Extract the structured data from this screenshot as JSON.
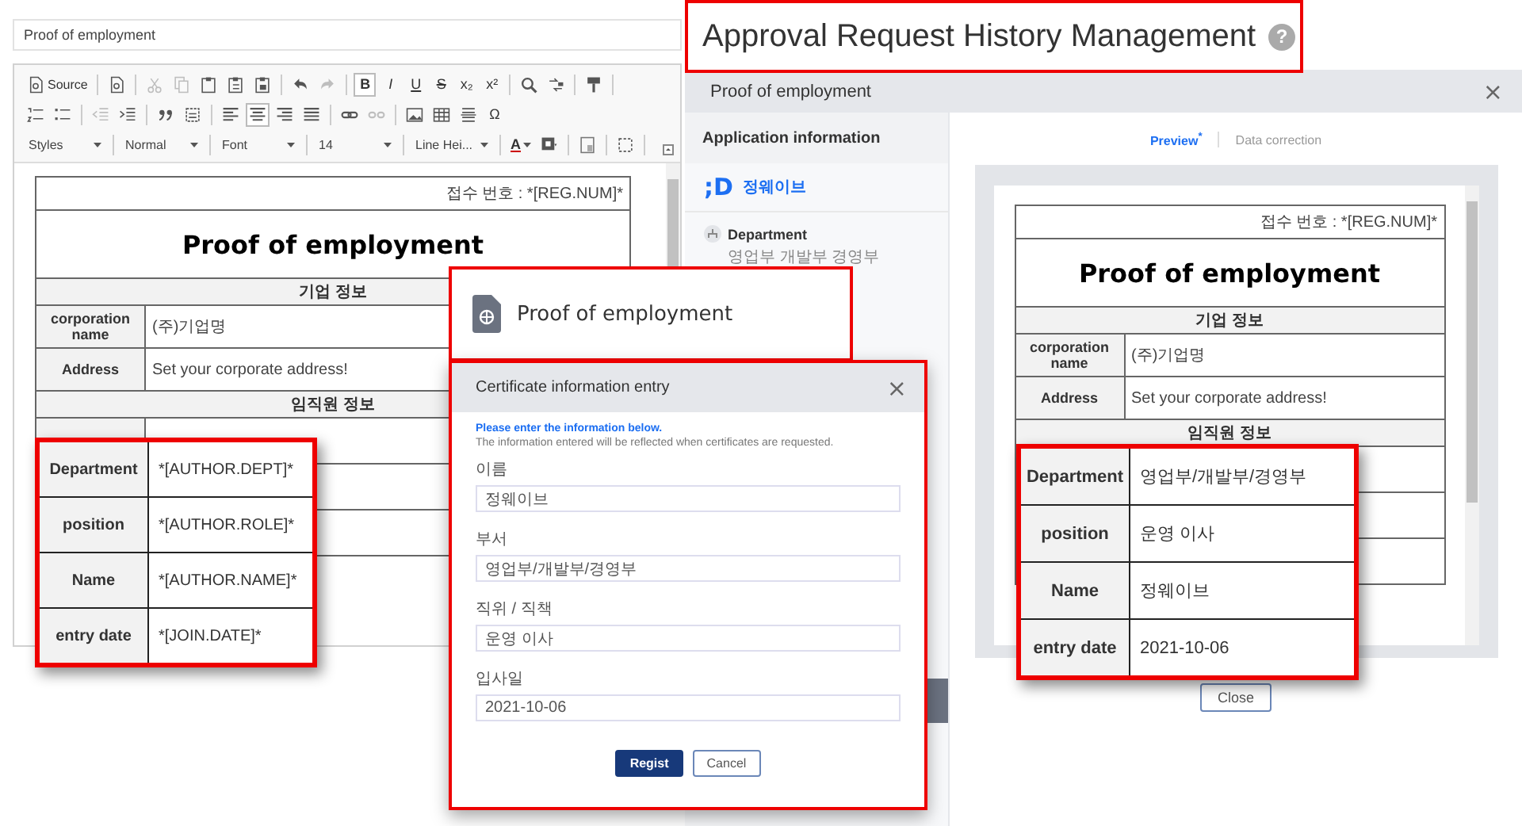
{
  "editor": {
    "title_field": "Proof of employment",
    "toolbar": [
      [
        {
          "kind": "source",
          "label": "Source",
          "disabled": false,
          "on": false
        },
        {
          "kind": "separator"
        },
        {
          "kind": "icon",
          "disabled": false,
          "on": false
        },
        {
          "kind": "separator"
        },
        {
          "kind": "icon",
          "disabled": true,
          "on": false
        },
        {
          "kind": "icon",
          "disabled": true,
          "on": false
        },
        {
          "kind": "icon",
          "disabled": false,
          "on": false
        },
        {
          "kind": "icon",
          "disabled": false,
          "on": false
        },
        {
          "kind": "icon",
          "disabled": false,
          "on": false
        },
        {
          "kind": "separator"
        },
        {
          "kind": "icon",
          "disabled": false,
          "on": false
        },
        {
          "kind": "icon",
          "disabled": true,
          "on": false
        },
        {
          "kind": "separator"
        },
        {
          "kind": "text",
          "label": "B",
          "disabled": false,
          "on": true
        },
        {
          "kind": "text",
          "label": "I",
          "disabled": false,
          "on": false
        },
        {
          "kind": "text",
          "label": "U",
          "disabled": false,
          "on": false
        },
        {
          "kind": "text",
          "label": "S",
          "disabled": false,
          "on": false
        },
        {
          "kind": "text",
          "label": "x₂",
          "disabled": false,
          "on": false
        },
        {
          "kind": "text",
          "label": "x²",
          "disabled": false,
          "on": false
        },
        {
          "kind": "separator"
        },
        {
          "kind": "icon",
          "disabled": false,
          "on": false
        },
        {
          "kind": "icon",
          "disabled": false,
          "on": false
        },
        {
          "kind": "separator"
        },
        {
          "kind": "icon",
          "disabled": false,
          "on": false
        },
        {
          "kind": "separator"
        }
      ],
      [
        {
          "kind": "icon",
          "disabled": false,
          "on": false
        },
        {
          "kind": "icon",
          "disabled": false,
          "on": false
        },
        {
          "kind": "separator"
        },
        {
          "kind": "icon",
          "disabled": true,
          "on": false
        },
        {
          "kind": "icon",
          "disabled": false,
          "on": false
        },
        {
          "kind": "separator"
        },
        {
          "kind": "icon",
          "disabled": false,
          "on": false
        },
        {
          "kind": "icon",
          "disabled": false,
          "on": false
        },
        {
          "kind": "separator"
        },
        {
          "kind": "icon",
          "disabled": false,
          "on": false
        },
        {
          "kind": "icon",
          "disabled": false,
          "on": true
        },
        {
          "kind": "icon",
          "disabled": false,
          "on": false
        },
        {
          "kind": "icon",
          "disabled": false,
          "on": false
        },
        {
          "kind": "separator"
        },
        {
          "kind": "icon",
          "disabled": false,
          "on": false
        },
        {
          "kind": "icon",
          "disabled": true,
          "on": false
        },
        {
          "kind": "separator"
        },
        {
          "kind": "icon",
          "disabled": false,
          "on": false
        },
        {
          "kind": "icon",
          "disabled": false,
          "on": false
        },
        {
          "kind": "icon",
          "disabled": false,
          "on": false
        },
        {
          "kind": "text",
          "label": "Ω",
          "disabled": false,
          "on": false
        }
      ],
      [
        {
          "kind": "dropdown",
          "label": "Styles"
        },
        {
          "kind": "separator"
        },
        {
          "kind": "dropdown",
          "label": "Normal"
        },
        {
          "kind": "separator"
        },
        {
          "kind": "dropdown",
          "label": "Font"
        },
        {
          "kind": "separator"
        },
        {
          "kind": "dropdown",
          "label": "14"
        },
        {
          "kind": "separator"
        },
        {
          "kind": "dropdown",
          "label": "Line Hei..."
        },
        {
          "kind": "separator"
        },
        {
          "kind": "color",
          "label": "A",
          "disabled": false,
          "on": false
        },
        {
          "kind": "icon",
          "disabled": false,
          "on": false
        },
        {
          "kind": "separator"
        },
        {
          "kind": "icon",
          "disabled": false,
          "on": false
        },
        {
          "kind": "separator"
        },
        {
          "kind": "icon",
          "disabled": false,
          "on": false
        },
        {
          "kind": "separator"
        }
      ]
    ],
    "document": {
      "reg_number": "접수 번호 : *[REG.NUM]*",
      "title": "Proof of employment",
      "company_section": "기업 정보",
      "company_rows": [
        {
          "label": "corporation name",
          "value": "(주)기업명"
        },
        {
          "label": "Address",
          "value": "Set your corporate address!"
        }
      ],
      "employee_section": "임직원 정보"
    },
    "callout": [
      {
        "label": "Department",
        "value": "*[AUTHOR.DEPT]*"
      },
      {
        "label": "position",
        "value": "*[AUTHOR.ROLE]*"
      },
      {
        "label": "Name",
        "value": "*[AUTHOR.NAME]*"
      },
      {
        "label": "entry date",
        "value": "*[JOIN.DATE]*"
      }
    ]
  },
  "page_heading": {
    "title": "Approval Request History Management",
    "help": "?"
  },
  "history_modal": {
    "title": "Proof of employment",
    "close": "×",
    "sidebar": {
      "heading": "Application information",
      "logo": ";D",
      "user_name": "정웨이브",
      "department_label": "Department",
      "department_value": "영업부 개발부 경영부"
    },
    "tabs": [
      {
        "label": "Preview$^{*}$",
        "selected": true
      },
      {
        "label": "Data correction",
        "selected": false
      }
    ],
    "document": {
      "reg_number": "접수 번호 : *[REG.NUM]*",
      "title": "Proof of employment",
      "company_section": "기업 정보",
      "company_rows": [
        {
          "label": "corporation name",
          "value": "(주)기업명"
        },
        {
          "label": "Address",
          "value": "Set your corporate address!"
        }
      ],
      "employee_section": "임직원 정보"
    },
    "callout": [
      {
        "label": "Department",
        "value": "영업부/개발부/경영부"
      },
      {
        "label": "position",
        "value": "운영 이사"
      },
      {
        "label": "Name",
        "value": "정웨이브"
      },
      {
        "label": "entry date",
        "value": "2021-10-06"
      }
    ],
    "close_button": "Close"
  },
  "certificate_card": {
    "title": "Proof of employment"
  },
  "entry_modal": {
    "title": "Certificate information entry",
    "close": "×",
    "note_title": "Please enter the information below.",
    "note": "The information entered will be reflected when certificates are requested.",
    "fields": [
      {
        "label": "이름",
        "value": "정웨이브"
      },
      {
        "label": "부서",
        "value": "영업부/개발부/경영부"
      },
      {
        "label": "직위 / 직책",
        "value": "운영 이사"
      },
      {
        "label": "입사일",
        "value": "2021-10-06"
      }
    ],
    "buttons": [
      {
        "label": "Regist",
        "kind": "primary"
      },
      {
        "label": "Cancel",
        "kind": "secondary"
      }
    ]
  }
}
